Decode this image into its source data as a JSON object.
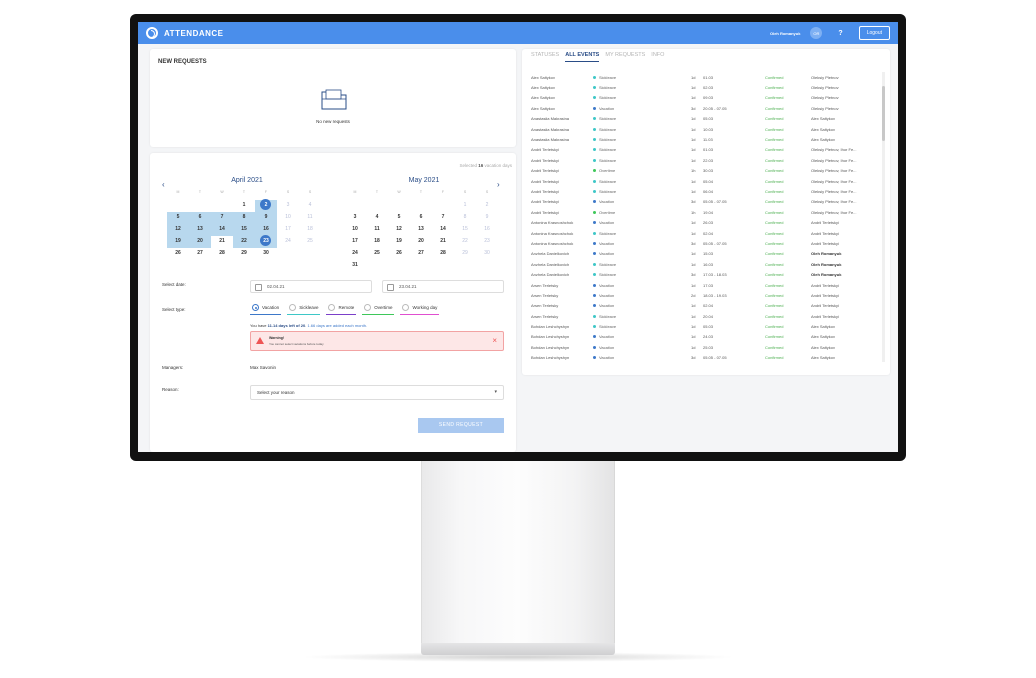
{
  "app": {
    "title": "ATTENDANCE",
    "user_name": "Oleh Romanyuk",
    "user_initials": "OR",
    "help": "?",
    "logout": "Logout"
  },
  "new_requests": {
    "title": "NEW REQUESTS",
    "empty_text": "No new requests"
  },
  "calendar": {
    "selected_prefix": "Selected ",
    "selected_count": "16",
    "selected_suffix": " vacation days",
    "weekdays": [
      "M",
      "T",
      "W",
      "T",
      "F",
      "S",
      "S"
    ],
    "april": {
      "title": "April 2021",
      "rows": [
        [
          "",
          "",
          "",
          "1",
          "2",
          "3",
          "4"
        ],
        [
          "5",
          "6",
          "7",
          "8",
          "9",
          "10",
          "11"
        ],
        [
          "12",
          "13",
          "14",
          "15",
          "16",
          "17",
          "18"
        ],
        [
          "19",
          "20",
          "21",
          "22",
          "23",
          "24",
          "25"
        ],
        [
          "26",
          "27",
          "28",
          "29",
          "30",
          "",
          ""
        ]
      ]
    },
    "may": {
      "title": "May 2021",
      "rows": [
        [
          "",
          "",
          "",
          "",
          "",
          "1",
          "2"
        ],
        [
          "3",
          "4",
          "5",
          "6",
          "7",
          "8",
          "9"
        ],
        [
          "10",
          "11",
          "12",
          "13",
          "14",
          "15",
          "16"
        ],
        [
          "17",
          "18",
          "19",
          "20",
          "21",
          "22",
          "23"
        ],
        [
          "24",
          "25",
          "26",
          "27",
          "28",
          "29",
          "30"
        ],
        [
          "31",
          "",
          "",
          "",
          "",
          "",
          ""
        ]
      ]
    }
  },
  "form": {
    "select_date_label": "Select date:",
    "date_from": "02.04.21",
    "date_to": "23.04.21",
    "select_type_label": "Select type:",
    "types": [
      {
        "label": "Vacation",
        "color": "#3d78c9"
      },
      {
        "label": "Sickleave",
        "color": "#3ec7c7"
      },
      {
        "label": "Remote",
        "color": "#7b3fc9"
      },
      {
        "label": "Overtime",
        "color": "#3ec75a"
      },
      {
        "label": "Working day",
        "color": "#e04fd0"
      }
    ],
    "vac_info_1": "You have ",
    "vac_info_days": "11.14 days left of 20",
    "vac_info_2": ". ",
    "vac_info_3": "1.66 days are added each month.",
    "warning_title": "Warning!",
    "warning_text": "You cannot select vacations before today",
    "managers_label": "Managers:",
    "manager_name": "Max Savonin",
    "reason_label": "Reason:",
    "reason_placeholder": "Select your reason",
    "send_button": "SEND REQUEST"
  },
  "tabs": [
    "STATUSES",
    "ALL EVENTS",
    "MY REQUESTS",
    "INFO"
  ],
  "events": [
    {
      "name": "Alex Saltykov",
      "type": "Sickleave",
      "dur": "1d",
      "date": "01.03",
      "status": "Confirmed",
      "manager": "Oleksiy Pletnov"
    },
    {
      "name": "Alex Saltykov",
      "type": "Sickleave",
      "dur": "1d",
      "date": "02.03",
      "status": "Confirmed",
      "manager": "Oleksiy Pletnov"
    },
    {
      "name": "Alex Saltykov",
      "type": "Sickleave",
      "dur": "1d",
      "date": "09.03",
      "status": "Confirmed",
      "manager": "Oleksiy Pletnov"
    },
    {
      "name": "Alex Saltykov",
      "type": "Vacation",
      "dur": "3d",
      "date": "20.05 - 07.05",
      "status": "Confirmed",
      "manager": "Oleksiy Pletnov"
    },
    {
      "name": "Anastasiia Makrasina",
      "type": "Sickleave",
      "dur": "1d",
      "date": "05.03",
      "status": "Confirmed",
      "manager": "Alex Saltykov"
    },
    {
      "name": "Anastasiia Makrasina",
      "type": "Sickleave",
      "dur": "1d",
      "date": "10.03",
      "status": "Confirmed",
      "manager": "Alex Saltykov"
    },
    {
      "name": "Anastasiia Makrasina",
      "type": "Sickleave",
      "dur": "1d",
      "date": "11.03",
      "status": "Confirmed",
      "manager": "Alex Saltykov"
    },
    {
      "name": "Andrii Terletskyi",
      "type": "Sickleave",
      "dur": "1d",
      "date": "01.03",
      "status": "Confirmed",
      "manager": "Oleksiy Pletnov, Ihor Fe..."
    },
    {
      "name": "Andrii Terletskyi",
      "type": "Sickleave",
      "dur": "1d",
      "date": "22.03",
      "status": "Confirmed",
      "manager": "Oleksiy Pletnov, Ihor Fe..."
    },
    {
      "name": "Andrii Terletskyi",
      "type": "Overtime",
      "dur": "1h",
      "date": "30.03",
      "status": "Confirmed",
      "manager": "Oleksiy Pletnov, Ihor Fe..."
    },
    {
      "name": "Andrii Terletskyi",
      "type": "Sickleave",
      "dur": "1d",
      "date": "05.04",
      "status": "Confirmed",
      "manager": "Oleksiy Pletnov, Ihor Fe..."
    },
    {
      "name": "Andrii Terletskyi",
      "type": "Sickleave",
      "dur": "1d",
      "date": "06.04",
      "status": "Confirmed",
      "manager": "Oleksiy Pletnov, Ihor Fe..."
    },
    {
      "name": "Andrii Terletskyi",
      "type": "Vacation",
      "dur": "3d",
      "date": "05.05 - 07.05",
      "status": "Confirmed",
      "manager": "Oleksiy Pletnov, Ihor Fe..."
    },
    {
      "name": "Andrii Terletskyi",
      "type": "Overtime",
      "dur": "1h",
      "date": "19.04",
      "status": "Confirmed",
      "manager": "Oleksiy Pletnov, Ihor Fe..."
    },
    {
      "name": "Antonina Krasnoshchok",
      "type": "Vacation",
      "dur": "1d",
      "date": "26.03",
      "status": "Confirmed",
      "manager": "Andrii Terletskyi"
    },
    {
      "name": "Antonina Krasnoshchok",
      "type": "Sickleave",
      "dur": "1d",
      "date": "02.04",
      "status": "Confirmed",
      "manager": "Andrii Terletskyi"
    },
    {
      "name": "Antonina Krasnoshchok",
      "type": "Vacation",
      "dur": "3d",
      "date": "05.05 - 07.05",
      "status": "Confirmed",
      "manager": "Andrii Terletskyi"
    },
    {
      "name": "Anzhela Danielkovich",
      "type": "Vacation",
      "dur": "1d",
      "date": "15.03",
      "status": "Confirmed",
      "manager": "Oleh Romanyuk",
      "bold": true
    },
    {
      "name": "Anzhela Danielkovich",
      "type": "Sickleave",
      "dur": "1d",
      "date": "16.03",
      "status": "Confirmed",
      "manager": "Oleh Romanyuk",
      "bold": true
    },
    {
      "name": "Anzhela Danielkovich",
      "type": "Sickleave",
      "dur": "3d",
      "date": "17.03 - 18.03",
      "status": "Confirmed",
      "manager": "Oleh Romanyuk",
      "bold": true
    },
    {
      "name": "Arsen Terletsky",
      "type": "Vacation",
      "dur": "1d",
      "date": "17.03",
      "status": "Confirmed",
      "manager": "Andrii Terletskyi"
    },
    {
      "name": "Arsen Terletsky",
      "type": "Vacation",
      "dur": "2d",
      "date": "18.03 - 19.03",
      "status": "Confirmed",
      "manager": "Andrii Terletskyi"
    },
    {
      "name": "Arsen Terletsky",
      "type": "Vacation",
      "dur": "1d",
      "date": "02.04",
      "status": "Confirmed",
      "manager": "Andrii Terletskyi"
    },
    {
      "name": "Arsen Terletsky",
      "type": "Sickleave",
      "dur": "1d",
      "date": "20.04",
      "status": "Confirmed",
      "manager": "Andrii Terletskyi"
    },
    {
      "name": "Bohdan Leshchyshyn",
      "type": "Sickleave",
      "dur": "1d",
      "date": "05.03",
      "status": "Confirmed",
      "manager": "Alex Saltykov"
    },
    {
      "name": "Bohdan Leshchyshyn",
      "type": "Vacation",
      "dur": "1d",
      "date": "24.03",
      "status": "Confirmed",
      "manager": "Alex Saltykov"
    },
    {
      "name": "Bohdan Leshchyshyn",
      "type": "Vacation",
      "dur": "1d",
      "date": "25.03",
      "status": "Confirmed",
      "manager": "Alex Saltykov"
    },
    {
      "name": "Bohdan Leshchyshyn",
      "type": "Vacation",
      "dur": "3d",
      "date": "05.05 - 07.05",
      "status": "Confirmed",
      "manager": "Alex Saltykov"
    }
  ],
  "type_colors": {
    "Sickleave": "#3ec7c7",
    "Vacation": "#3d78c9",
    "Overtime": "#3ec75a",
    "Remote": "#7b3fc9"
  }
}
